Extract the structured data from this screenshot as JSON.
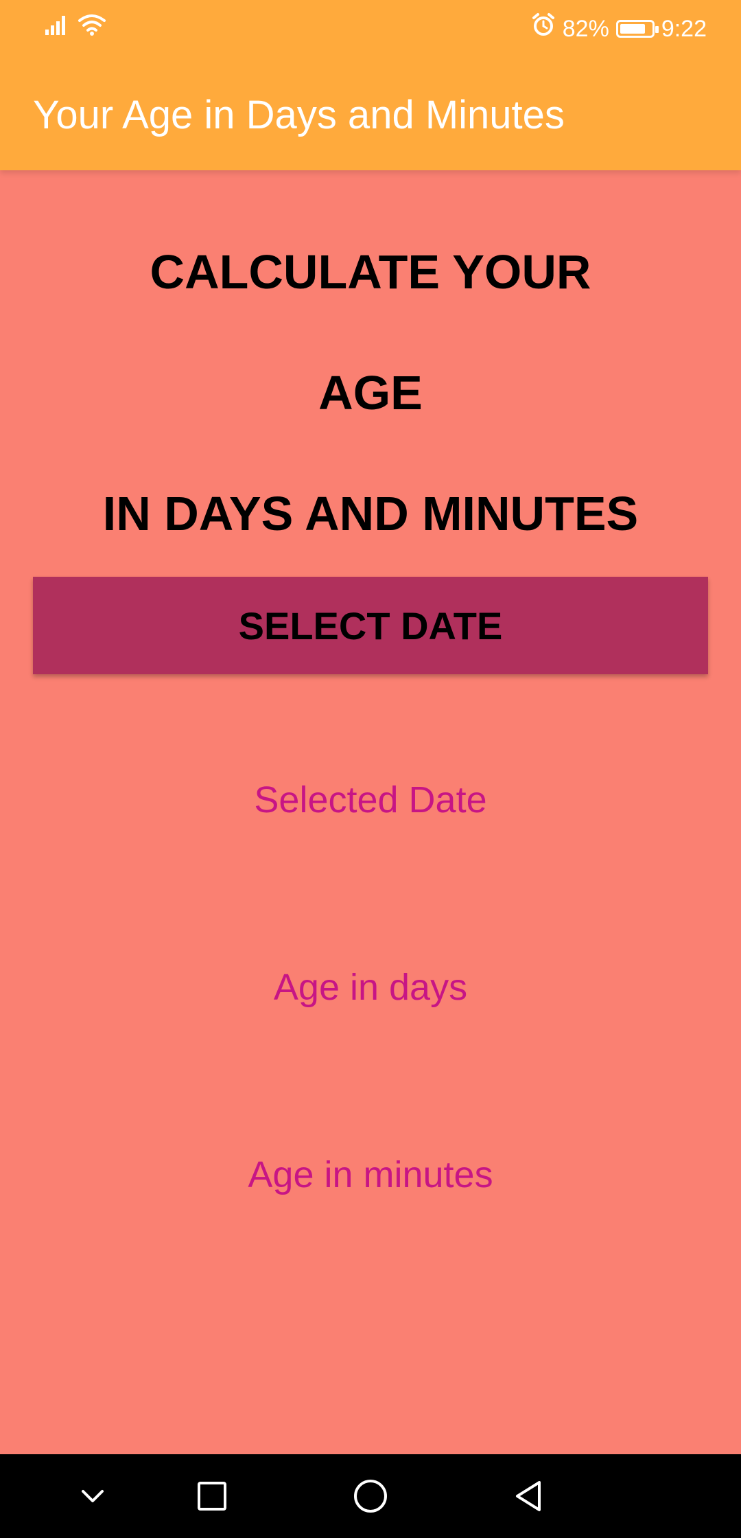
{
  "status_bar": {
    "battery_percent": "82%",
    "battery_level": 0.82,
    "time": "9:22",
    "icons": [
      "signal-icon",
      "wifi-icon",
      "alarm-icon",
      "battery-icon"
    ]
  },
  "app_bar": {
    "title": "Your Age in Days and Minutes",
    "color": "#FFAA3C"
  },
  "main": {
    "background": "#FA8072",
    "headline_lines": [
      "CALCULATE YOUR",
      "AGE",
      "IN DAYS AND MINUTES"
    ],
    "select_button_label": "SELECT DATE",
    "select_button_color": "#B0305C",
    "selected_date_label": "Selected Date",
    "age_in_days_label": "Age in days",
    "age_in_minutes_label": "Age in minutes",
    "accent_text_color": "#C71585"
  },
  "nav_bar": {
    "buttons": [
      "chevron-down-icon",
      "recents-square-icon",
      "home-circle-icon",
      "back-triangle-icon"
    ]
  }
}
